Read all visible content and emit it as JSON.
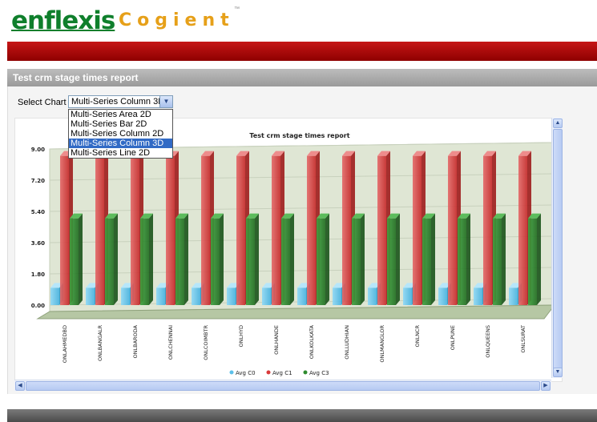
{
  "logo": {
    "brand": "enflexis",
    "product": "Cogient",
    "tm": "™"
  },
  "panel": {
    "title": "Test crm stage times report"
  },
  "select_chart": {
    "label": "Select Chart",
    "value": "Multi-Series Column 3D",
    "options": [
      "Multi-Series Area 2D",
      "Multi-Series Bar 2D",
      "Multi-Series Column 2D",
      "Multi-Series Column 3D",
      "Multi-Series Line 2D"
    ],
    "selected_index": 3
  },
  "colors": {
    "avg_c0": "#5bc0ea",
    "avg_c1": "#d93a3a",
    "avg_c3": "#2e8b2e",
    "header_red": "#b10b0b"
  },
  "icons": {
    "scroll_up": "chevron-up-icon",
    "scroll_down": "chevron-down-icon",
    "scroll_left": "chevron-left-icon",
    "scroll_right": "chevron-right-icon",
    "dropdown": "chevron-down-icon"
  },
  "chart_data": {
    "type": "bar",
    "title": "Test crm stage times report",
    "categories": [
      "ONLAHMEDBD",
      "ONLBANGALR",
      "ONLBARODA",
      "ONLCHENNAI",
      "ONLCOIMBTR",
      "ONLHYD",
      "ONLHANDE",
      "ONLKOLKATA",
      "ONLLUDHIAN",
      "ONLMANGLOR",
      "ONLNCR",
      "ONLPUNE",
      "ONLQUEENS",
      "ONLSURAT"
    ],
    "series": [
      {
        "name": "Avg C0",
        "values": [
          1.0,
          1.0,
          1.0,
          1.0,
          1.0,
          1.0,
          1.0,
          1.0,
          1.0,
          1.0,
          1.0,
          1.0,
          1.0,
          1.0
        ]
      },
      {
        "name": "Avg C1",
        "values": [
          8.6,
          8.6,
          8.6,
          8.6,
          8.6,
          8.6,
          8.6,
          8.6,
          8.6,
          8.6,
          8.6,
          8.6,
          8.6,
          8.6
        ]
      },
      {
        "name": "Avg C3",
        "values": [
          5.0,
          5.0,
          5.0,
          5.0,
          5.0,
          5.0,
          5.0,
          5.0,
          5.0,
          5.0,
          5.0,
          5.0,
          5.0,
          5.0
        ]
      }
    ],
    "yticks": [
      "0.00",
      "1.80",
      "3.60",
      "5.40",
      "7.20",
      "9.00"
    ],
    "ylim": [
      0,
      9
    ],
    "legend": "bottom"
  }
}
